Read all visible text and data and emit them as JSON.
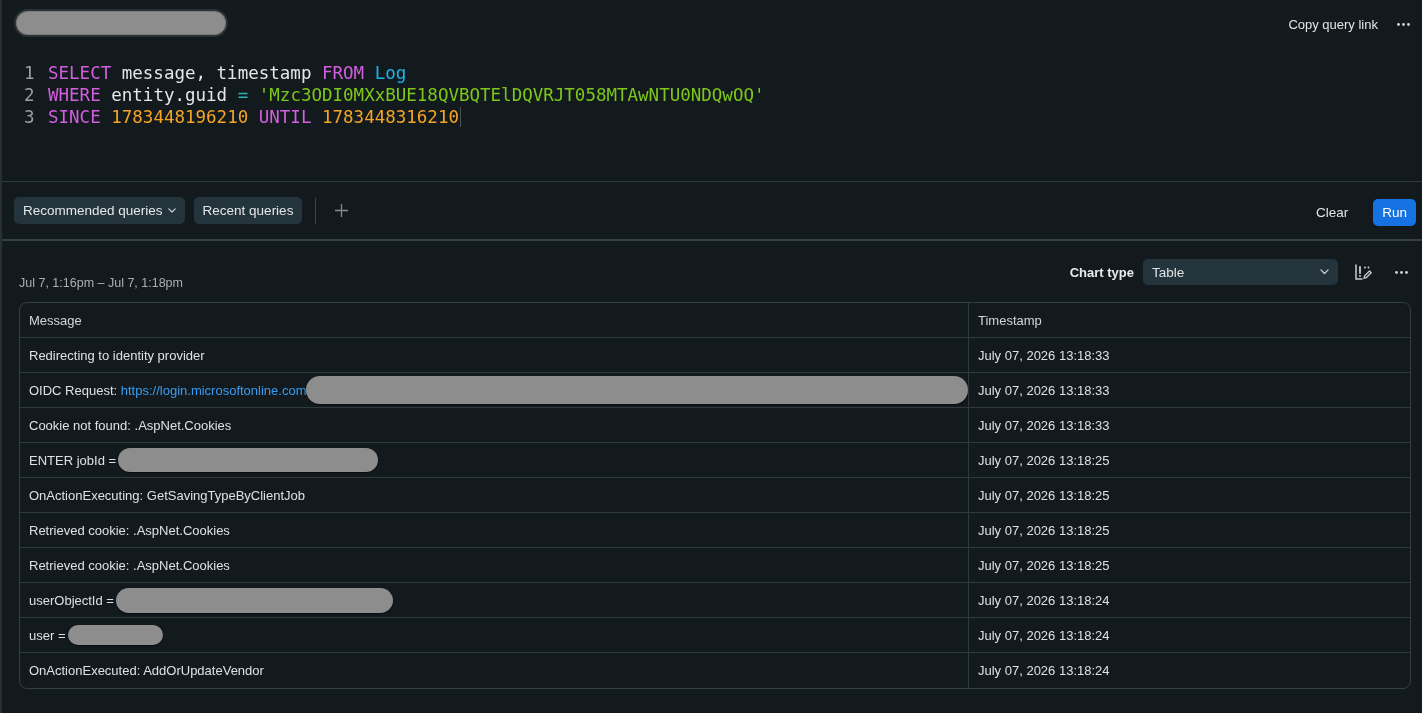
{
  "query_title": {
    "redacted": true
  },
  "header_actions": {
    "copy_link": "Copy query link"
  },
  "editor": {
    "lines": [
      {
        "number": "1",
        "caret": false,
        "tokens": [
          {
            "kind": "keyword",
            "text": "SELECT"
          },
          {
            "kind": "identifier",
            "text": "message, timestamp"
          },
          {
            "kind": "keyword",
            "text": "FROM"
          },
          {
            "kind": "table",
            "text": "Log"
          }
        ]
      },
      {
        "number": "2",
        "caret": false,
        "tokens": [
          {
            "kind": "keyword",
            "text": "WHERE"
          },
          {
            "kind": "identifier",
            "text": "entity.guid"
          },
          {
            "kind": "operator",
            "text": "="
          },
          {
            "kind": "string",
            "text": "'Mzc3ODI0MXxBUE18QVBQTElDQVRJT058MTAwNTU0NDQwOQ'"
          }
        ]
      },
      {
        "number": "3",
        "caret": true,
        "tokens": [
          {
            "kind": "keyword",
            "text": "SINCE"
          },
          {
            "kind": "number",
            "text": "1783448196210"
          },
          {
            "kind": "keyword",
            "text": "UNTIL"
          },
          {
            "kind": "number",
            "text": "1783448316210"
          }
        ]
      }
    ]
  },
  "toolbar": {
    "buttons": [
      {
        "kind": "dropdown",
        "label": "Recommended queries"
      },
      {
        "kind": "plain",
        "label": "Recent queries"
      }
    ],
    "clear": "Clear",
    "run": "Run"
  },
  "results": {
    "time_range": "Jul 7, 1:16pm – Jul 7, 1:18pm",
    "chart_type": {
      "label": "Chart type",
      "value": "Table"
    },
    "table": {
      "columns": [
        "Message",
        "Timestamp"
      ],
      "rows": [
        {
          "message": {
            "text": "Redirecting to identity provider",
            "redacted": false
          },
          "timestamp": "July 07, 2026 13:18:33"
        },
        {
          "message": {
            "text": "OIDC Request:",
            "link": "https://login.microsoftonline.com",
            "redacted": true
          },
          "timestamp": "July 07, 2026 13:18:33"
        },
        {
          "message": {
            "text": "Cookie not found: .AspNet.Cookies",
            "redacted": false
          },
          "timestamp": "July 07, 2026 13:18:33"
        },
        {
          "message": {
            "text": "ENTER jobId =",
            "redacted": true
          },
          "timestamp": "July 07, 2026 13:18:25"
        },
        {
          "message": {
            "text": "OnActionExecuting: GetSavingTypeByClientJob",
            "redacted": false
          },
          "timestamp": "July 07, 2026 13:18:25"
        },
        {
          "message": {
            "text": "Retrieved cookie: .AspNet.Cookies",
            "redacted": false
          },
          "timestamp": "July 07, 2026 13:18:25"
        },
        {
          "message": {
            "text": "Retrieved cookie: .AspNet.Cookies",
            "redacted": false
          },
          "timestamp": "July 07, 2026 13:18:25"
        },
        {
          "message": {
            "text": "userObjectId =",
            "redacted": true
          },
          "timestamp": "July 07, 2026 13:18:24"
        },
        {
          "message": {
            "text": "user =",
            "redacted": true
          },
          "timestamp": "July 07, 2026 13:18:24"
        },
        {
          "message": {
            "text": "OnActionExecuted: AddOrUpdateVendor",
            "redacted": false
          },
          "timestamp": "July 07, 2026 13:18:24"
        }
      ]
    }
  }
}
